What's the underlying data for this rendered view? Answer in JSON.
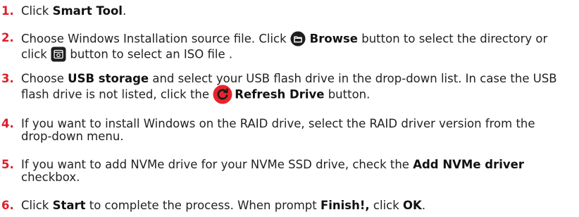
{
  "steps": [
    {
      "number": "1.",
      "parts": {
        "a": "Click ",
        "b": "Smart Tool",
        "c": "."
      }
    },
    {
      "number": "2.",
      "parts": {
        "a": "Choose Windows Installation source file. Click ",
        "b": " Browse",
        "c": " button to select the directory or click ",
        "d": " button to select an ISO file ."
      },
      "icons": [
        "browse-folder-icon",
        "iso-file-icon"
      ]
    },
    {
      "number": "3.",
      "parts": {
        "a": "Choose ",
        "b": "USB storage",
        "c": " and select your USB flash drive in the drop-down list. In case the USB flash drive is not listed, click the ",
        "d": "Refresh Drive",
        "e": " button."
      },
      "icons": [
        "refresh-icon"
      ]
    },
    {
      "number": "4.",
      "parts": {
        "a": "If you want to install Windows on the RAID drive, select the RAID driver version from the drop-down menu."
      }
    },
    {
      "number": "5.",
      "parts": {
        "a": "If you want to add NVMe drive for your NVMe SSD drive, check the ",
        "b": "Add NVMe driver",
        "c": " checkbox."
      }
    },
    {
      "number": "6.",
      "parts": {
        "a": "Click ",
        "b": "Start",
        "c": " to complete the process. When prompt ",
        "d": "Finish!,",
        "e": " click ",
        "f": "OK",
        "g": "."
      }
    }
  ],
  "colors": {
    "step_number": "#e11d2a",
    "text": "#222222",
    "icon_dark": "#1e1e1e",
    "refresh_icon_bg": "#e8232c"
  }
}
